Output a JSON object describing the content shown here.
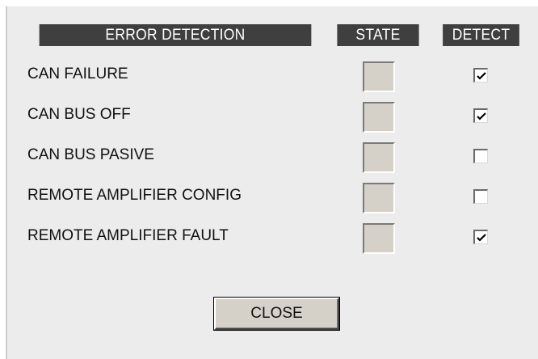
{
  "headers": {
    "error_detection": "ERROR DETECTION",
    "state": "STATE",
    "detect": "DETECT"
  },
  "rows": [
    {
      "label": "CAN FAILURE",
      "detect": true
    },
    {
      "label": "CAN BUS OFF",
      "detect": true
    },
    {
      "label": "CAN BUS PASIVE",
      "detect": false
    },
    {
      "label": "REMOTE AMPLIFIER CONFIG",
      "detect": false
    },
    {
      "label": "REMOTE AMPLIFIER FAULT",
      "detect": true
    }
  ],
  "buttons": {
    "close_label": "CLOSE"
  },
  "colors": {
    "panel_background": "#ececec",
    "header_background": "#3f3f3f",
    "header_text": "#ffffff",
    "state_box": "#d5d1c9"
  }
}
